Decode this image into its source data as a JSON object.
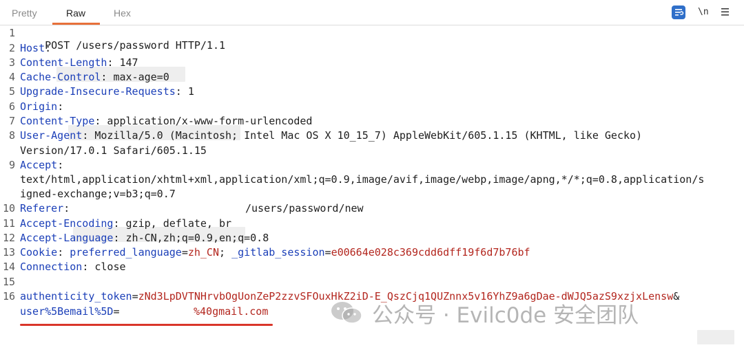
{
  "tabs": [
    "Pretty",
    "Raw",
    "Hex"
  ],
  "active_tab": "Raw",
  "toolbar": {
    "newline_label": "\\n",
    "menu_label": "≡"
  },
  "line_numbers": [
    "1",
    "2",
    "3",
    "4",
    "5",
    "6",
    "7",
    "8",
    "9",
    "10",
    "11",
    "12",
    "13",
    "14",
    "15",
    "16"
  ],
  "request": {
    "request_line": "POST /users/password HTTP/1.1",
    "host_name": "Host",
    "cl_name": "Content-Length",
    "cl_value": " 147",
    "cc_name": "Cache-Control",
    "cc_value": " max-age=0",
    "uir_name": "Upgrade-Insecure-Requests",
    "uir_value": " 1",
    "origin_name": "Origin",
    "ct_name": "Content-Type",
    "ct_value": " application/x-www-form-urlencoded",
    "ua_name": "User-Agent",
    "ua_value_1": " Mozilla/5.0 (Macintosh; Intel Mac OS X 10_15_7) AppleWebKit/605.1.15 (KHTML, like Gecko)",
    "ua_value_2": "Version/17.0.1 Safari/605.1.15",
    "accept_name": "Accept",
    "accept_value_1": "text/html,application/xhtml+xml,application/xml;q=0.9,image/avif,image/webp,image/apng,*/*;q=0.8,application/s",
    "accept_value_2": "igned-exchange;v=b3;q=0.7",
    "referer_name": "Referer",
    "referer_suffix": "/users/password/new",
    "ae_name": "Accept-Encoding",
    "ae_value": " gzip, deflate, br",
    "al_name": "Accept-Language",
    "al_value": " zh-CN,zh;q=0.9,en;q=0.8",
    "cookie_name": "Cookie",
    "cookie_p1_name": "preferred_language",
    "cookie_p1_value": "zh_CN",
    "cookie_sep": "; ",
    "cookie_p2_name": "_gitlab_session",
    "cookie_p2_value": "e00664e028c369cdd6dff19f6d7b76bf",
    "conn_name": "Connection",
    "conn_value": " close",
    "body_p1_name": "authenticity_token",
    "body_p1_value": "zNd3LpDVTNHrvbOgUonZeP2zzvSFOuxHkZ2iD-E_QszCjq1QUZnnx5v16YhZ9a6gDae-dWJQ5azS9xzjxLensw",
    "body_amp": "&",
    "body_p2_name": "user%5Bemail%5D",
    "body_p2_value": "%40gmail.com"
  },
  "watermark": {
    "text": "公众号 · Evilc0de 安全团队"
  },
  "colors": {
    "header_name": "#1b3fb8",
    "param_value": "#b3261e",
    "active_tab_underline": "#e8703a",
    "annotation_underline": "#d9352a",
    "wrap_button": "#2f6fc9"
  }
}
